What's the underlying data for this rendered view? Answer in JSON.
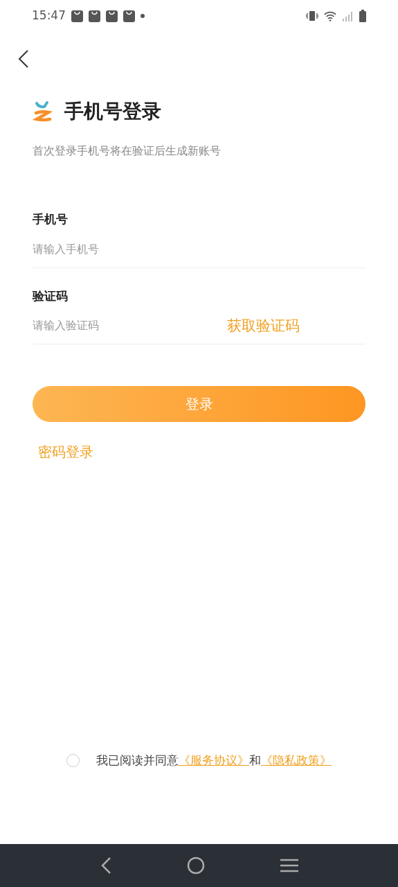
{
  "status_bar": {
    "time": "15:47"
  },
  "title": "手机号登录",
  "subtitle": "首次登录手机号将在验证后生成新账号",
  "fields": [
    {
      "label": "手机号",
      "placeholder": "请输入手机号"
    },
    {
      "label": "验证码",
      "placeholder": "请输入验证码",
      "action": "获取验证码"
    }
  ],
  "login_button": "登录",
  "password_login": "密码登录",
  "agreement": {
    "checked": false,
    "text": "我已阅读并同意",
    "links": [
      "《服务协议》",
      "《隐私政策》"
    ],
    "joiner": "和"
  }
}
